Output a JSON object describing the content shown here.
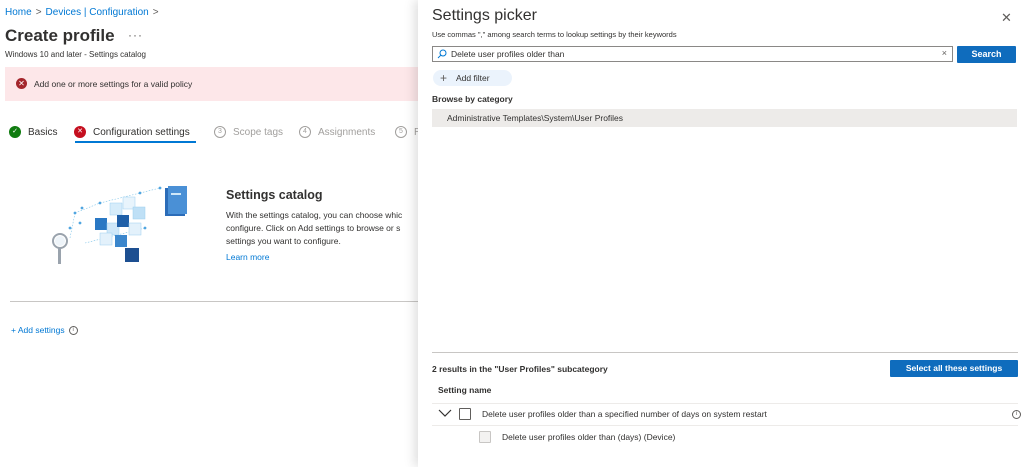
{
  "breadcrumb": {
    "items": [
      "Home",
      "Devices | Configuration"
    ],
    "separator": ">"
  },
  "page": {
    "title": "Create profile",
    "more": "···",
    "subtitle": "Windows 10 and later - Settings catalog"
  },
  "error": {
    "icon": "error-circle-icon",
    "message": "Add one or more settings for a valid policy"
  },
  "steps": [
    {
      "bullet": "✓",
      "label": "Basics",
      "state": "done"
    },
    {
      "bullet": "✕",
      "label": "Configuration settings",
      "state": "current"
    },
    {
      "bullet": "3",
      "label": "Scope tags",
      "state": "todo"
    },
    {
      "bullet": "4",
      "label": "Assignments",
      "state": "todo"
    },
    {
      "bullet": "5",
      "label": "R",
      "state": "todo"
    }
  ],
  "catalog": {
    "title": "Settings catalog",
    "description": "With the settings catalog, you can choose whic configure. Click on Add settings to browse or s settings you want to configure.",
    "learn_more": "Learn more"
  },
  "add_settings": {
    "label": "+ Add settings",
    "info_glyph": "i"
  },
  "picker": {
    "title": "Settings picker",
    "close_glyph": "✕",
    "hint": "Use commas \",\" among search terms to lookup settings by their keywords",
    "search_value": "Delete user profiles older than",
    "search_placeholder": "",
    "clear_glyph": "×",
    "search_button": "Search",
    "add_filter_plus": "+",
    "add_filter_label": "Add filter",
    "browse_label": "Browse by category",
    "category": "Administrative Templates\\System\\User Profiles",
    "results_label": "2 results in the \"User Profiles\" subcategory",
    "select_all": "Select all these settings",
    "column_header": "Setting name",
    "results": [
      {
        "text": "Delete user profiles older than a specified number of days on system restart",
        "info": "i"
      },
      {
        "text": "Delete user profiles older than (days) (Device)"
      }
    ]
  },
  "colors": {
    "accent": "#0078d4",
    "button": "#0f6cbd",
    "error_bg": "#fde7e9",
    "error_icon": "#a4262c",
    "success": "#107c10",
    "category_bg": "#edebe9"
  }
}
